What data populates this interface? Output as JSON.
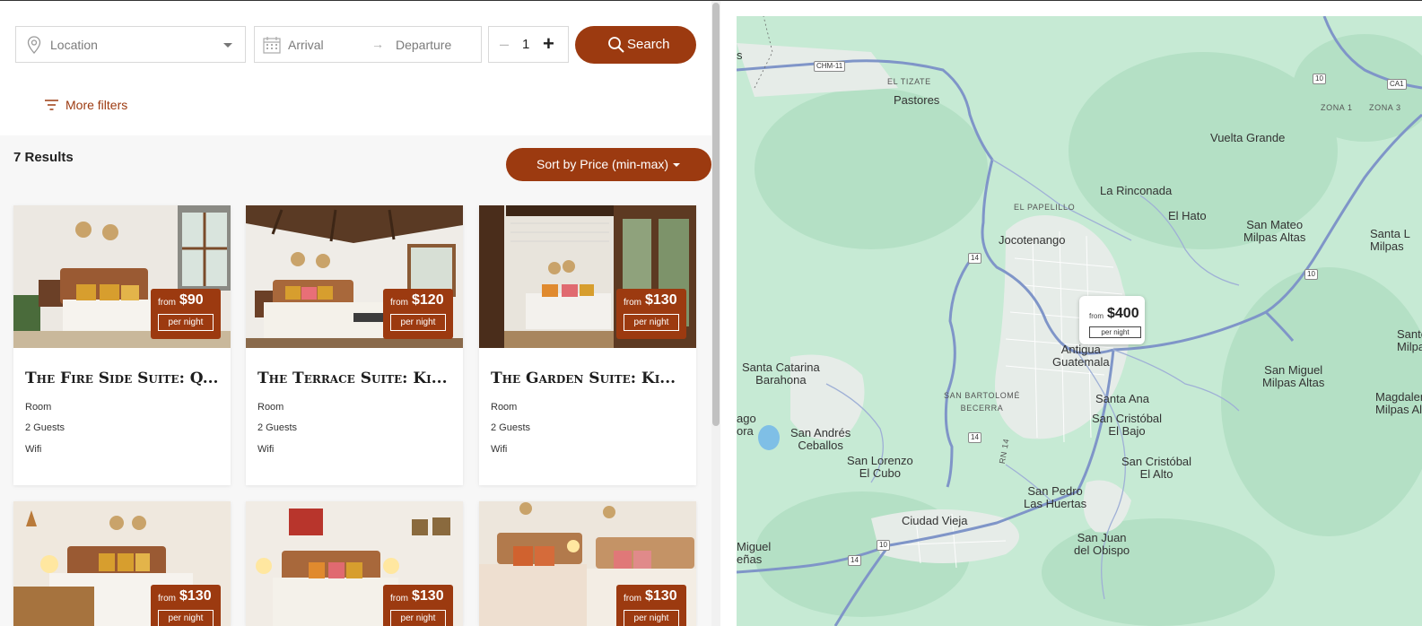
{
  "search": {
    "location_placeholder": "Location",
    "arrival_placeholder": "Arrival",
    "departure_placeholder": "Departure",
    "guests_value": "1",
    "search_label": "Search",
    "more_filters_label": "More filters"
  },
  "results": {
    "count_label": "7 Results",
    "sort_label": "Sort by Price (min-max)"
  },
  "listings": [
    {
      "title": "The Fire Side Suite: Q...",
      "from": "from",
      "price": "$90",
      "per_night": "per night",
      "type": "Room",
      "guests": "2 Guests",
      "amenity": "Wifi"
    },
    {
      "title": "The Terrace Suite: Ki...",
      "from": "from",
      "price": "$120",
      "per_night": "per night",
      "type": "Room",
      "guests": "2 Guests",
      "amenity": "Wifi"
    },
    {
      "title": "The Garden Suite: Ki...",
      "from": "from",
      "price": "$130",
      "per_night": "per night",
      "type": "Room",
      "guests": "2 Guests",
      "amenity": "Wifi"
    },
    {
      "from": "from",
      "price": "$130",
      "per_night": "per night"
    },
    {
      "from": "from",
      "price": "$130",
      "per_night": "per night"
    },
    {
      "from": "from",
      "price": "$130",
      "per_night": "per night"
    }
  ],
  "map": {
    "marker": {
      "from": "from",
      "price": "$400",
      "per_night": "per night"
    },
    "places": {
      "el_tizate": "EL TIZATE",
      "pastores": "Pastores",
      "vuelta_grande": "Vuelta Grande",
      "la_rinconada": "La Rinconada",
      "el_papelillo": "EL PAPELILLO",
      "el_hato": "El Hato",
      "jocotenango": "Jocotenango",
      "san_mateo": "San Mateo\nMilpas Altas",
      "santa_edge": "Santa L\nMilpas",
      "antigua": "Antigua\nGuatemala",
      "santa_catarina": "Santa Catarina\nBarahona",
      "san_bartolome": "SAN BARTOLOMÉ\nBECERRA",
      "santa_ana": "Santa Ana",
      "san_cristobal_bajo": "San Cristóbal\nEl Bajo",
      "san_miguel_altas": "San Miguel\nMilpas Altas",
      "magdalena": "Magdalen\nMilpas Alt",
      "santo_edge": "Santo\nMilpa",
      "ago": "ago\nora",
      "san_andres": "San Andrés\nCeballos",
      "san_lorenzo": "San Lorenzo\nEl Cubo",
      "san_cristobal_alto": "San Cristóbal\nEl Alto",
      "san_pedro": "San Pedro\nLas Huertas",
      "ciudad_vieja": "Ciudad Vieja",
      "san_juan": "San Juan\ndel Obispo",
      "miguel_edge": "Miguel\neñas",
      "zona1": "ZONA 1",
      "zona3": "ZONA 3",
      "s_edge": "s"
    },
    "roads": {
      "chm11": "CHM-11",
      "r14a": "14",
      "r14b": "14",
      "r14c": "14",
      "r10a": "10",
      "r10b": "10",
      "r10c": "10",
      "rn14": "RN 14",
      "ca1": "CA1"
    }
  }
}
